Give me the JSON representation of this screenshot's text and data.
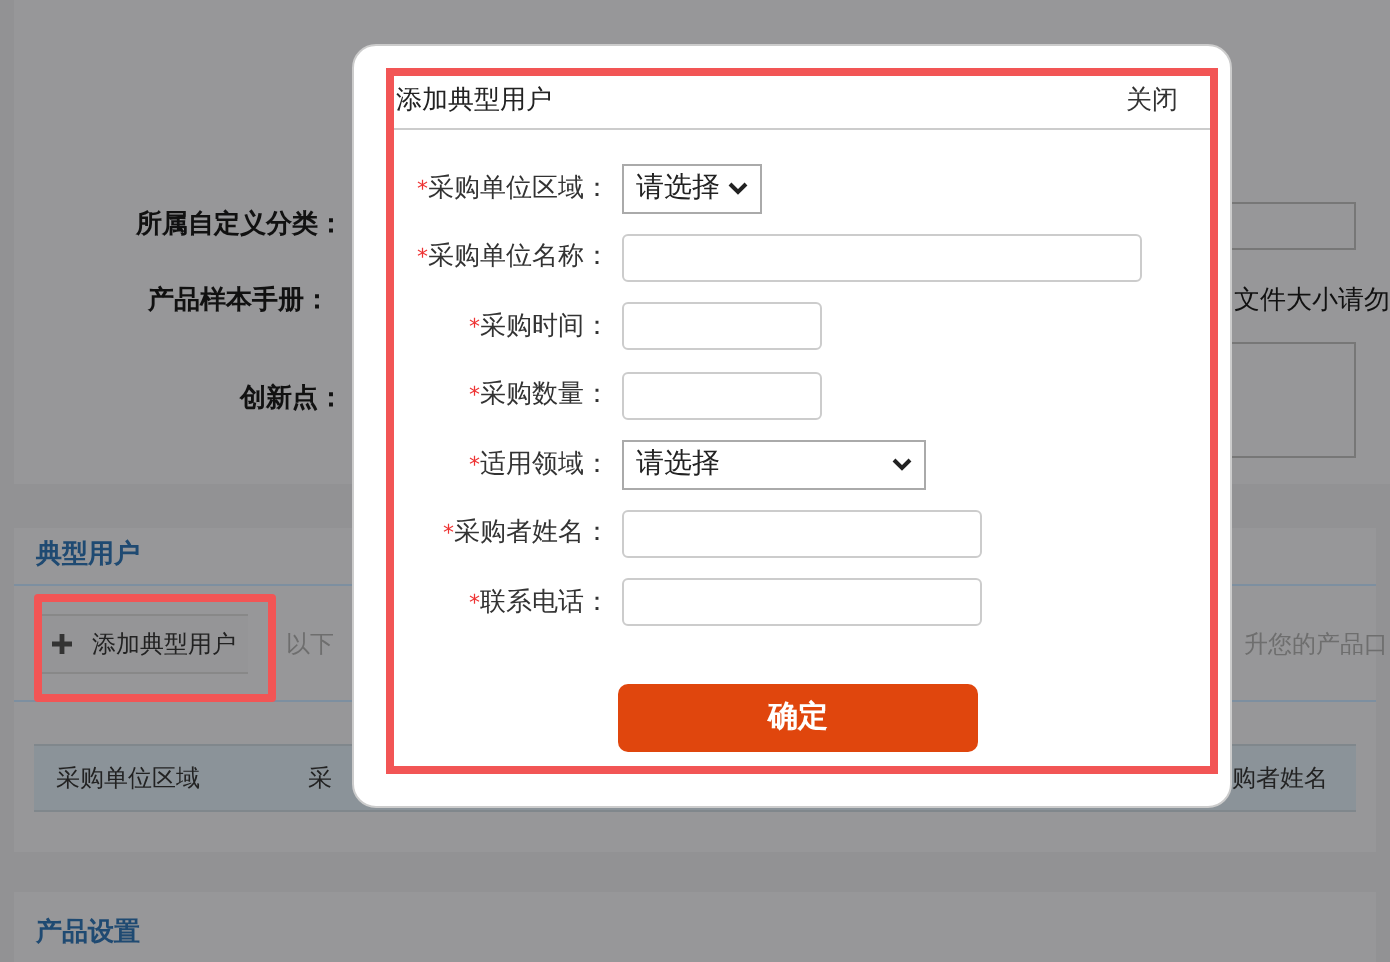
{
  "background_form": {
    "fields": [
      {
        "label": "所属自定义分类：",
        "kind": "input"
      },
      {
        "label": "产品样本手册：",
        "kind": "note",
        "note": "文件大小请勿"
      },
      {
        "label": "创新点：",
        "kind": "textarea"
      }
    ]
  },
  "typical_users_section": {
    "title": "典型用户",
    "add_button": "添加典型用户",
    "hint_start": "以下",
    "hint_end": "升您的产品口",
    "columns": [
      "采购单位区域",
      "采",
      "购者姓名"
    ]
  },
  "product_settings_section": {
    "title": "产品设置"
  },
  "dialog": {
    "title": "添加典型用户",
    "close": "关闭",
    "fields": [
      {
        "marker": "*",
        "label": "采购单位区域：",
        "kind": "select",
        "value": "请选择"
      },
      {
        "marker": "*",
        "label": "采购单位名称：",
        "kind": "input"
      },
      {
        "marker": "*",
        "label": "采购时间：",
        "kind": "input"
      },
      {
        "marker": "*",
        "label": "采购数量：",
        "kind": "input"
      },
      {
        "marker": "*",
        "label": "适用领域：",
        "kind": "select",
        "value": "请选择"
      },
      {
        "marker": "*",
        "label": "采购者姓名：",
        "kind": "input"
      },
      {
        "marker": "*",
        "label": "联系电话：",
        "kind": "input"
      }
    ],
    "submit": "确定"
  }
}
